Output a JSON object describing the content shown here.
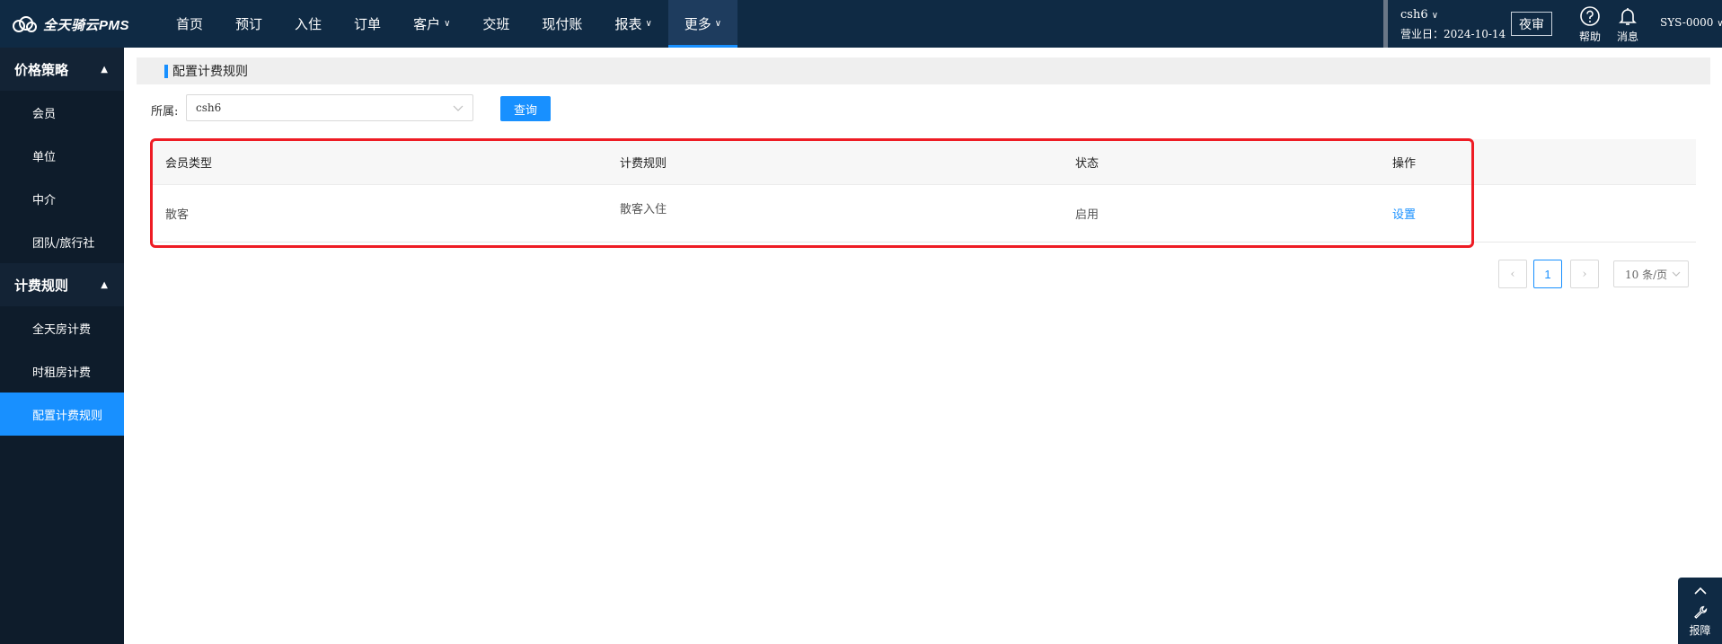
{
  "app": {
    "brand": "全天骑云PMS",
    "colors": {
      "topbar": "#0f2a44",
      "sidebar": "#0e1c2b",
      "accent": "#1890ff",
      "highlight": "#ee1c24"
    }
  },
  "nav": {
    "items": [
      {
        "label": "首页",
        "dropdown": false
      },
      {
        "label": "预订",
        "dropdown": false
      },
      {
        "label": "入住",
        "dropdown": false
      },
      {
        "label": "订单",
        "dropdown": false
      },
      {
        "label": "客户",
        "dropdown": true
      },
      {
        "label": "交班",
        "dropdown": false
      },
      {
        "label": "现付账",
        "dropdown": false
      },
      {
        "label": "报表",
        "dropdown": true
      },
      {
        "label": "更多",
        "dropdown": true,
        "active": true
      }
    ]
  },
  "header": {
    "hotel": "csh6",
    "business_date": "营业日：2024-10-14",
    "night_audit_label": "夜审",
    "help_label": "帮助",
    "message_label": "消息",
    "user": "SYS-0000"
  },
  "sidebar": {
    "groups": [
      {
        "title": "价格策略",
        "items": [
          "会员",
          "单位",
          "中介",
          "团队/旅行社"
        ]
      },
      {
        "title": "计费规则",
        "items": [
          "全天房计费",
          "时租房计费",
          "配置计费规则"
        ]
      }
    ],
    "active_item": "配置计费规则"
  },
  "page": {
    "title": "配置计费规则",
    "filter_label": "所属:",
    "filter_value": "csh6",
    "query_label": "查询"
  },
  "table": {
    "columns": [
      "会员类型",
      "计费规则",
      "状态",
      "操作"
    ],
    "rows": [
      {
        "member_type": "散客",
        "rule": "散客入住",
        "status": "启用",
        "action": "设置"
      }
    ]
  },
  "pagination": {
    "current_page": "1",
    "page_size": "10 条/页"
  },
  "support": {
    "label": "报障"
  }
}
